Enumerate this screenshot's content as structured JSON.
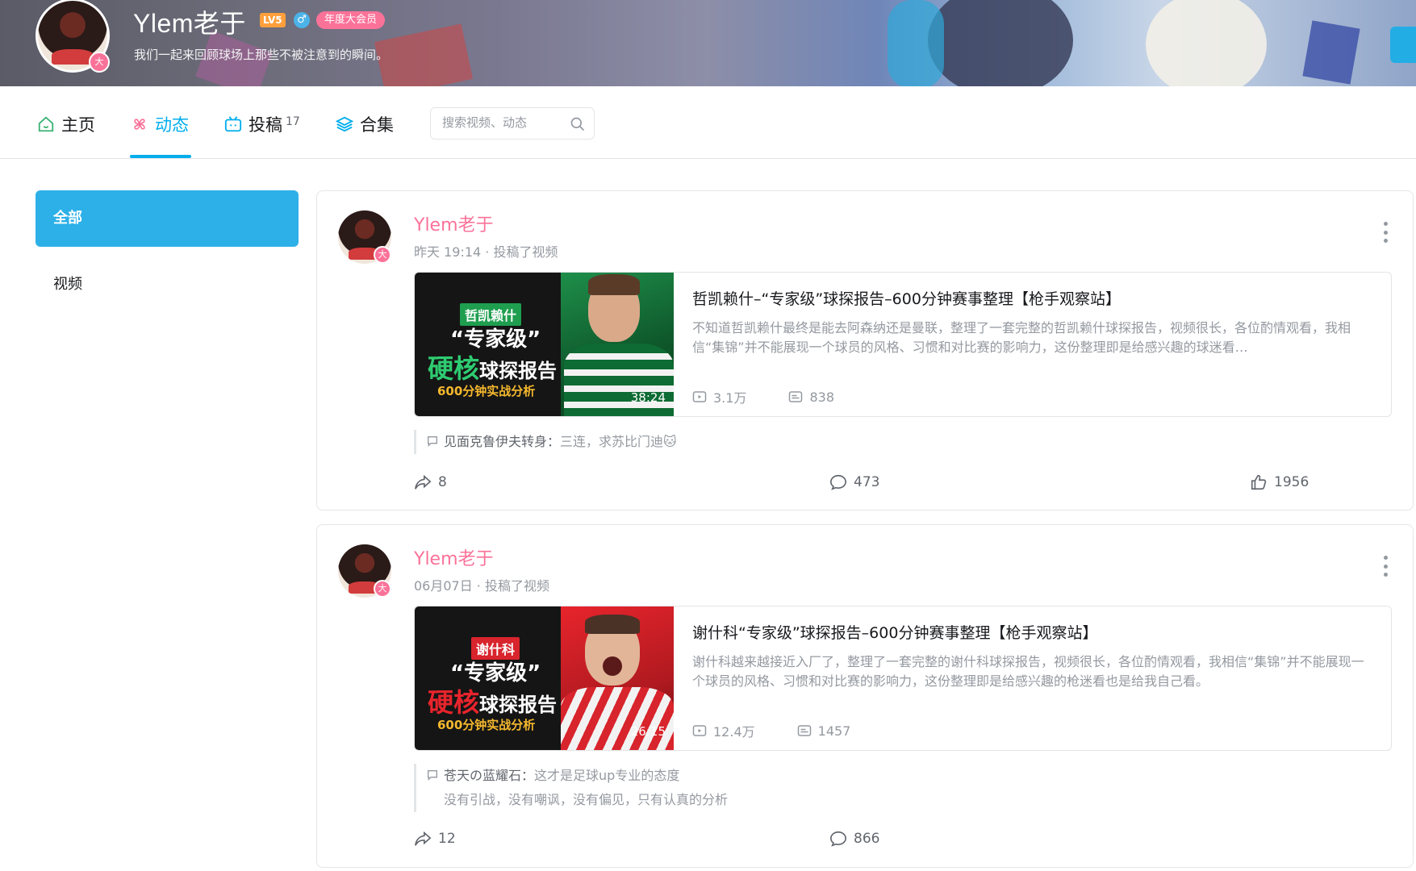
{
  "header": {
    "username": "Ylem老于",
    "level": "LV5",
    "sex_symbol": "♂",
    "vip_label": "年度大会员",
    "signature": "我们一起来回顾球场上那些不被注意到的瞬间。",
    "avatar_badge": "大"
  },
  "nav": {
    "home": "主页",
    "dynamic": "动态",
    "videos": "投稿",
    "videos_count": "17",
    "collections": "合集",
    "search_placeholder": "搜索视频、动态"
  },
  "sidebar": {
    "items": [
      {
        "label": "全部",
        "active": true
      },
      {
        "label": "视频",
        "active": false
      }
    ]
  },
  "posts": [
    {
      "author": "Ylem老于",
      "meta": "昨天 19:14 · 投稿了视频",
      "thumb": {
        "tag": "哲凯赖什",
        "line1": "“专家级”",
        "line2_accent": "硬核",
        "line2_rest": "球探报告",
        "line3": "600分钟实战分析",
        "duration": "38:24",
        "accent_color": "#2ecc71"
      },
      "title": "哲凯赖什–“专家级”球探报告–600分钟赛事整理【枪手观察站】",
      "description": "不知道哲凯赖什最终是能去阿森纳还是曼联，整理了一套完整的哲凯赖什球探报告，视频很长，各位酌情观看，我相信“集锦”并不能展现一个球员的风格、习惯和对比赛的影响力，这份整理即是给感兴趣的球迷看…",
      "views": "3.1万",
      "danmaku": "838",
      "comment_user": "见面克鲁伊夫转身",
      "comment_text": "三连，求苏比门迪🐱",
      "comment_text2": "",
      "shares": "8",
      "comments": "473",
      "likes": "1956"
    },
    {
      "author": "Ylem老于",
      "meta": "06月07日 · 投稿了视频",
      "thumb": {
        "tag": "谢什科",
        "line1": "“专家级”",
        "line2_accent": "硬核",
        "line2_rest": "球探报告",
        "line3": "600分钟实战分析",
        "duration": "26:15",
        "accent_color": "#e8242c"
      },
      "title": "谢什科“专家级”球探报告–600分钟赛事整理【枪手观察站】",
      "description": "谢什科越来越接近入厂了，整理了一套完整的谢什科球探报告，视频很长，各位酌情观看，我相信“集锦”并不能展现一个球员的风格、习惯和对比赛的影响力，这份整理即是给感兴趣的枪迷看也是给我自己看。",
      "views": "12.4万",
      "danmaku": "1457",
      "comment_user": "苍天の蓝耀石",
      "comment_text": "这才是足球up专业的态度",
      "comment_text2": "没有引战，没有嘲讽，没有偏见，只有认真的分析",
      "shares": "12",
      "comments": "866",
      "likes": ""
    }
  ],
  "colors": {
    "accent": "#00aeec",
    "username": "#fb7299",
    "vip": "#fb7299"
  }
}
